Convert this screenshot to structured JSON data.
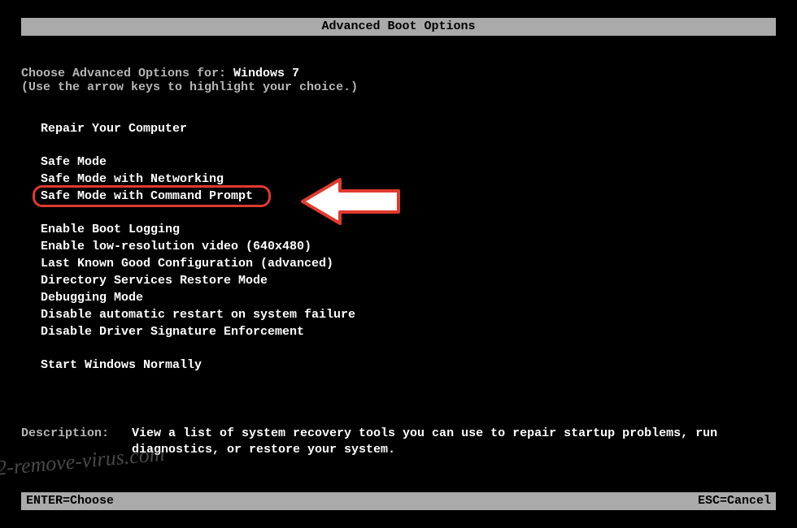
{
  "title": "Advanced Boot Options",
  "intro": {
    "prefix": "Choose Advanced Options for: ",
    "os": "Windows 7",
    "hint": "(Use the arrow keys to highlight your choice.)"
  },
  "groups": [
    {
      "items": [
        "Repair Your Computer"
      ]
    },
    {
      "items": [
        "Safe Mode",
        "Safe Mode with Networking",
        "Safe Mode with Command Prompt"
      ],
      "highlightIndex": 2
    },
    {
      "items": [
        "Enable Boot Logging",
        "Enable low-resolution video (640x480)",
        "Last Known Good Configuration (advanced)",
        "Directory Services Restore Mode",
        "Debugging Mode",
        "Disable automatic restart on system failure",
        "Disable Driver Signature Enforcement"
      ]
    },
    {
      "items": [
        "Start Windows Normally"
      ]
    }
  ],
  "description": {
    "label": "Description:",
    "text": "View a list of system recovery tools you can use to repair startup problems, run diagnostics, or restore your system."
  },
  "footer": {
    "enter": "ENTER=Choose",
    "esc": "ESC=Cancel"
  },
  "watermark": "2-remove-virus.com"
}
